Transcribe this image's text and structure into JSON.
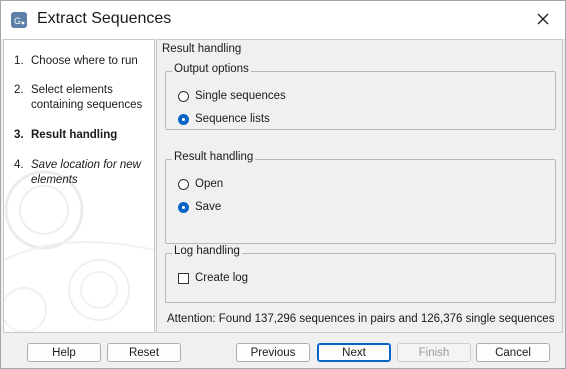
{
  "window": {
    "title": "Extract Sequences"
  },
  "icons": {
    "app": "app-icon",
    "close": "close-icon"
  },
  "steps": [
    {
      "num": "1.",
      "label": "Choose where to run"
    },
    {
      "num": "2.",
      "label": "Select elements containing sequences"
    },
    {
      "num": "3.",
      "label": "Result handling"
    },
    {
      "num": "4.",
      "label": "Save location for new elements"
    }
  ],
  "panel": {
    "title": "Result handling",
    "output_options": {
      "title": "Output options",
      "options": [
        "Single sequences",
        "Sequence lists"
      ],
      "selected": "Sequence lists"
    },
    "result_handling": {
      "title": "Result handling",
      "options": [
        "Open",
        "Save"
      ],
      "selected": "Save"
    },
    "log_handling": {
      "title": "Log handling",
      "create_log_label": "Create log",
      "create_log_checked": false
    },
    "attention": "Attention: Found 137,296 sequences in pairs and 126,376 single sequences"
  },
  "buttons": {
    "help": "Help",
    "reset": "Reset",
    "previous": "Previous",
    "next": "Next",
    "finish": "Finish",
    "cancel": "Cancel"
  },
  "colors": {
    "accent": "#0a64c8",
    "border": "#b8b8b8",
    "background": "#f0f0f0"
  }
}
